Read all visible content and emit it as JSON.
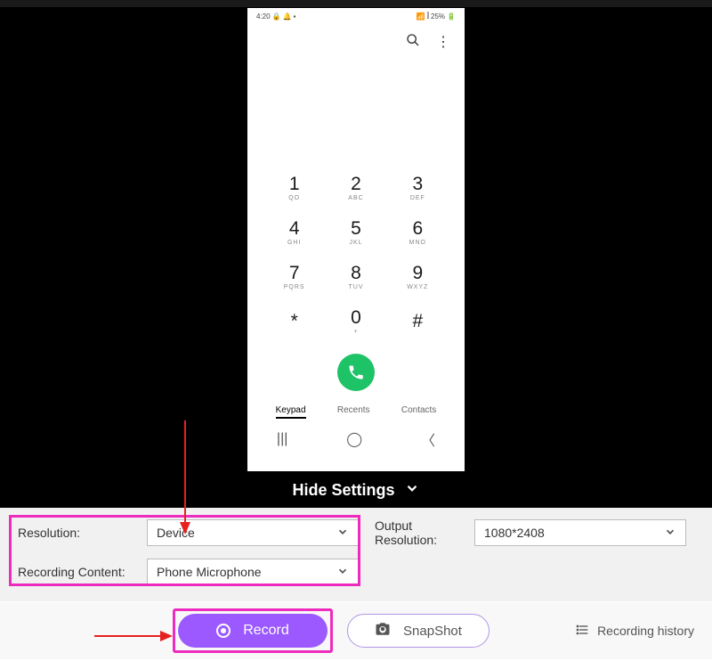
{
  "phone": {
    "status_time": "4:20",
    "status_battery": "25%",
    "keys": [
      {
        "d": "1",
        "l": "QO"
      },
      {
        "d": "2",
        "l": "ABC"
      },
      {
        "d": "3",
        "l": "DEF"
      },
      {
        "d": "4",
        "l": "GHI"
      },
      {
        "d": "5",
        "l": "JKL"
      },
      {
        "d": "6",
        "l": "MNO"
      },
      {
        "d": "7",
        "l": "PQRS"
      },
      {
        "d": "8",
        "l": "TUV"
      },
      {
        "d": "9",
        "l": "WXYZ"
      },
      {
        "d": "*",
        "l": ""
      },
      {
        "d": "0",
        "l": "+"
      },
      {
        "d": "#",
        "l": ""
      }
    ],
    "tabs": {
      "keypad": "Keypad",
      "recents": "Recents",
      "contacts": "Contacts"
    }
  },
  "hide_settings": "Hide Settings",
  "settings": {
    "resolution_label": "Resolution:",
    "resolution_value": "Device",
    "recording_label": "Recording Content:",
    "recording_value": "Phone Microphone",
    "output_label": "Output Resolution:",
    "output_value": "1080*2408"
  },
  "buttons": {
    "record": "Record",
    "snapshot": "SnapShot",
    "history": "Recording history"
  }
}
